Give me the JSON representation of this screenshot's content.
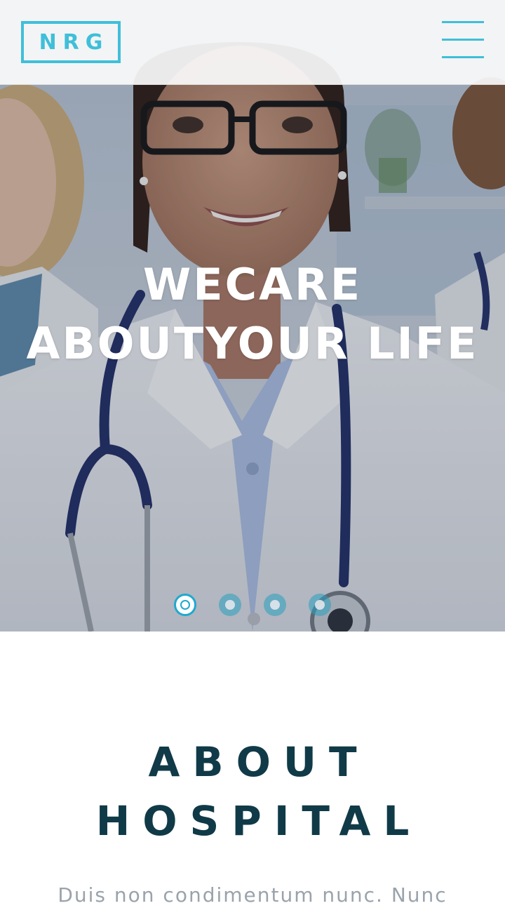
{
  "header": {
    "logo_text": "NRG",
    "menu_icon": "hamburger-menu-icon"
  },
  "hero": {
    "title_line1": "WECARE",
    "title_line2": "ABOUTYOUR LIFE",
    "slider": {
      "total": 4,
      "active_index": 0
    }
  },
  "about": {
    "title_line1": "ABOUT",
    "title_line2": "HOSPITAL",
    "text": "Duis non condimentum nunc. Nunc"
  },
  "colors": {
    "accent": "#3fbfd9",
    "heading": "#103a47",
    "body_text": "#9aa3ab"
  }
}
